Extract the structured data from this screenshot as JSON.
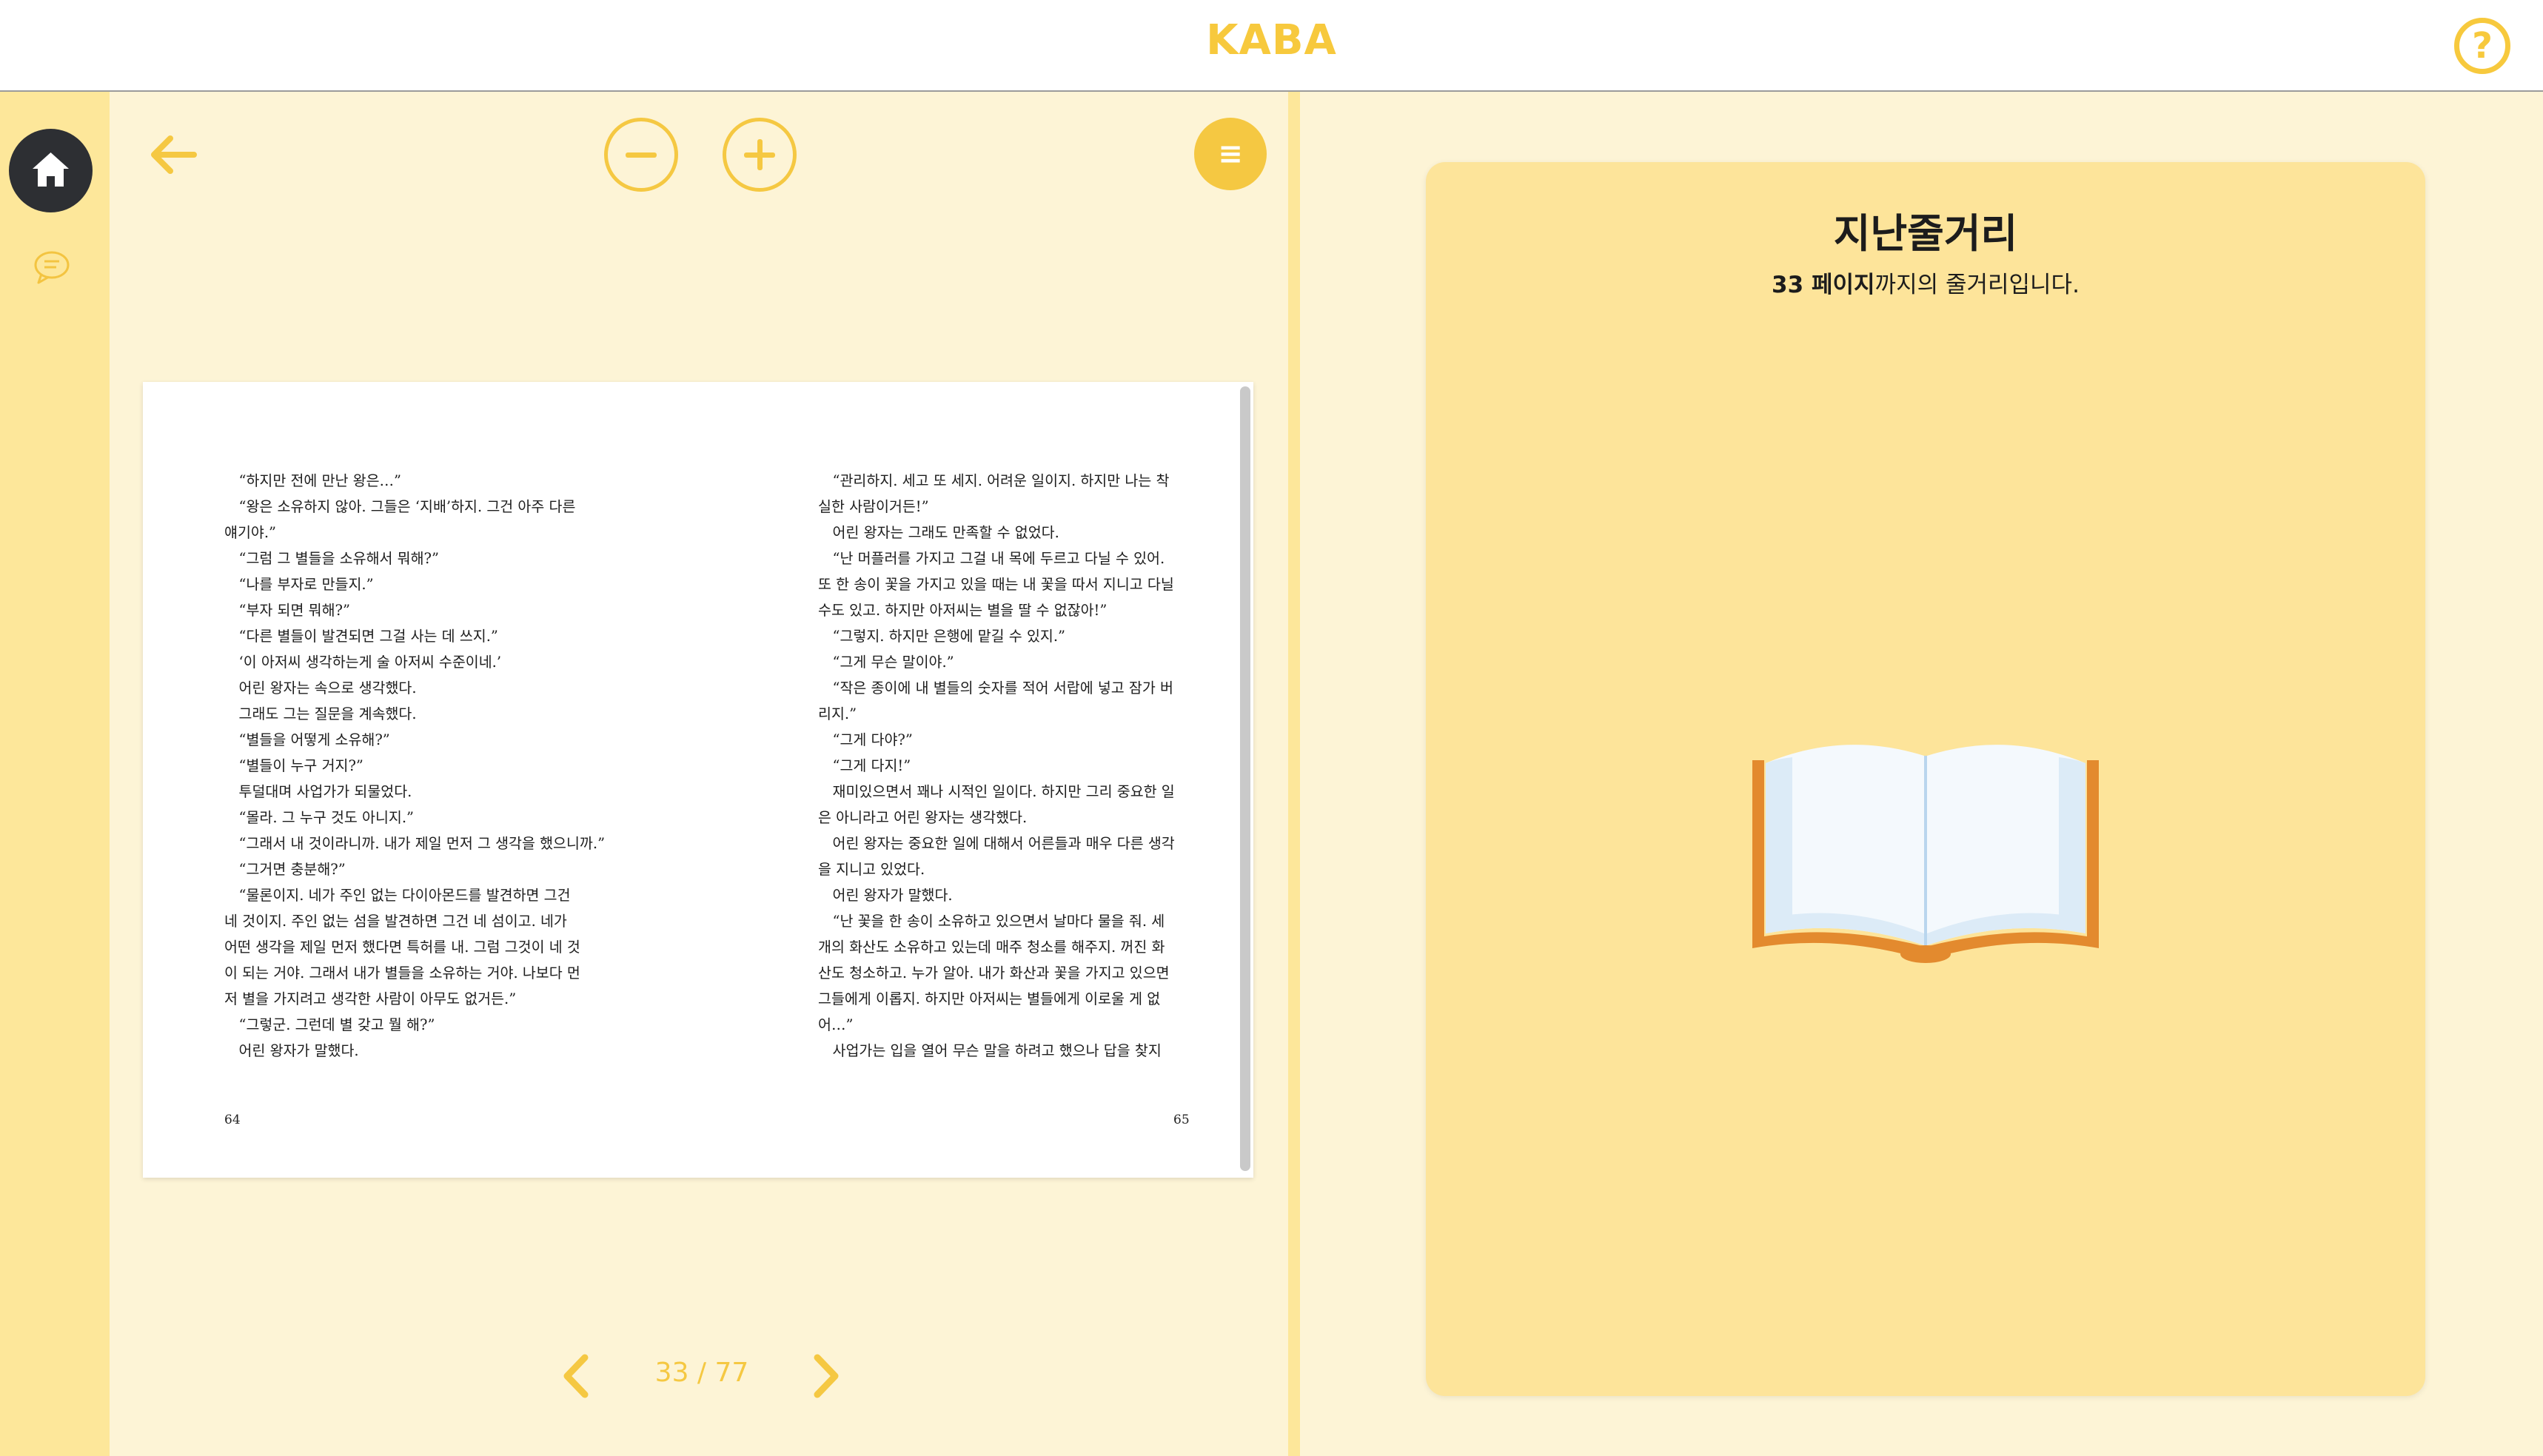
{
  "app": {
    "brand": "KABA",
    "help_label": "?"
  },
  "sidebar": {
    "items": [
      {
        "name": "home",
        "icon": "home-icon",
        "active": true
      },
      {
        "name": "chat",
        "icon": "chat-bubble-icon",
        "active": false
      }
    ]
  },
  "reader": {
    "toolbar": {
      "menu_label": "≡"
    },
    "left_page": {
      "number": "64",
      "lines": [
        "　“하지만 전에 만난 왕은…”",
        "　“왕은 소유하지 않아. 그들은 ‘지배’하지. 그건 아주 다른",
        "얘기야.”",
        "　“그럼 그 별들을 소유해서 뭐해?”",
        "　“나를 부자로 만들지.”",
        "　“부자 되면 뭐해?”",
        "　“다른 별들이 발견되면 그걸 사는 데 쓰지.”",
        "　‘이 아저씨 생각하는게 술 아저씨 수준이네.’",
        "　어린 왕자는 속으로 생각했다.",
        "　그래도 그는 질문을 계속했다.",
        "　“별들을 어떻게 소유해?”",
        "　“별들이 누구 거지?”",
        "　투덜대며 사업가가 되물었다.",
        "　“몰라. 그 누구 것도 아니지.”",
        "　“그래서 내 것이라니까. 내가 제일 먼저 그 생각을 했으니까.”",
        "　“그거면 충분해?”",
        "　“물론이지. 네가 주인 없는 다이아몬드를 발견하면 그건",
        "네 것이지. 주인 없는 섬을 발견하면 그건 네 섬이고. 네가",
        "어떤 생각을 제일 먼저 했다면 특허를 내. 그럼 그것이 네 것",
        "이 되는 거야. 그래서 내가 별들을 소유하는 거야. 나보다 먼",
        "저 별을 가지려고 생각한 사람이 아무도 없거든.”",
        "　“그렇군. 그런데 별 갖고 뭘 해?”",
        "　어린 왕자가 말했다."
      ]
    },
    "right_page": {
      "number": "65",
      "lines": [
        "　“관리하지. 세고 또 세지. 어려운 일이지. 하지만 나는 착",
        "실한 사람이거든!”",
        "　어린 왕자는 그래도 만족할 수 없었다.",
        "　“난 머플러를 가지고 그걸 내 목에 두르고 다닐 수 있어.",
        "또 한 송이 꽃을 가지고 있을 때는 내 꽃을 따서 지니고 다닐",
        "수도 있고. 하지만 아저씨는 별을 딸 수 없잖아!”",
        "　“그렇지. 하지만 은행에 맡길 수 있지.”",
        "　“그게 무슨 말이야.”",
        "　“작은 종이에 내 별들의 숫자를 적어 서랍에 넣고 잠가 버",
        "리지.”",
        "　“그게 다야?”",
        "　“그게 다지!”",
        "　재미있으면서 꽤나 시적인 일이다. 하지만 그리 중요한 일",
        "은 아니라고 어린 왕자는 생각했다.",
        "　어린 왕자는 중요한 일에 대해서 어른들과 매우 다른 생각",
        "을 지니고 있었다.",
        "　어린 왕자가 말했다.",
        "　“난 꽃을 한 송이 소유하고 있으면서 날마다 물을 줘. 세",
        "개의 화산도 소유하고 있는데 매주 청소를 해주지. 꺼진 화",
        "산도 청소하고. 누가 알아. 내가 화산과 꽃을 가지고 있으면",
        "그들에게 이롭지. 하지만 아저씨는 별들에게 이로울 게 없",
        "어…”",
        "　사업가는 입을 열어 무슨 말을 하려고 했으나 답을 찾지"
      ]
    },
    "pager": {
      "current": "33",
      "separator": " / ",
      "total": "77",
      "display": "33 / 77"
    }
  },
  "summary": {
    "title": "지난줄거리",
    "subtitle_bold": "33 페이지",
    "subtitle_rest": "까지의 줄거리입니다."
  },
  "colors": {
    "accent": "#f5c842",
    "sidebar_bg": "#fde79a",
    "panel_bg": "#fdf4d6",
    "card_bg": "#fde49a",
    "home_bg": "#2d2f33",
    "book_cover": "#e38a2e",
    "book_page": "#f4f9fd"
  }
}
